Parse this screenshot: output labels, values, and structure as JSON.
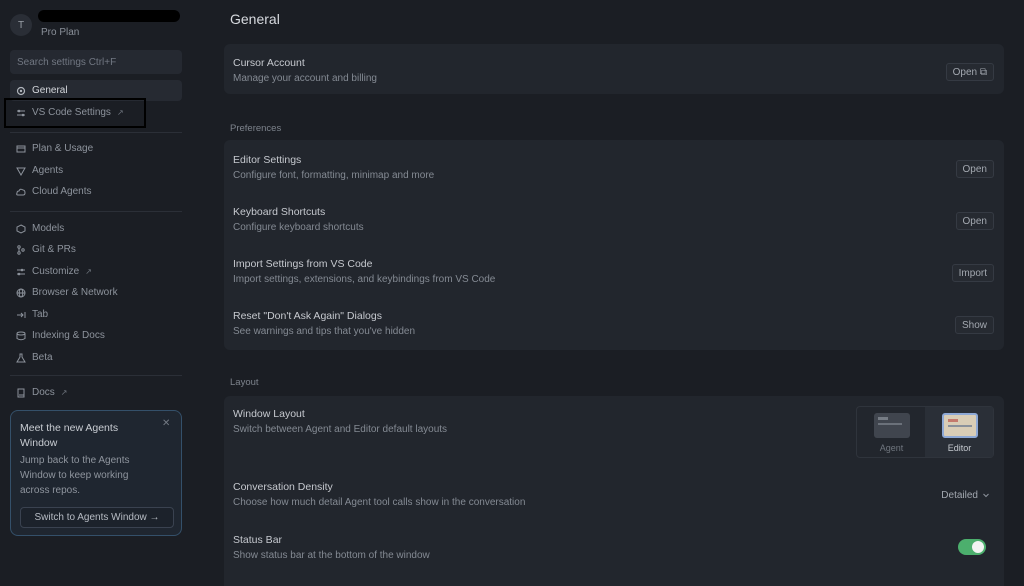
{
  "sidebar": {
    "avatar_letter": "T",
    "plan": "Pro Plan",
    "search_placeholder": "Search settings Ctrl+F",
    "items": [
      {
        "label": "General",
        "icon": "gear-icon"
      },
      {
        "label": "VS Code Settings",
        "icon": "sliders-icon",
        "external": "↗"
      },
      {
        "label": "Plan & Usage",
        "icon": "card-icon"
      },
      {
        "label": "Agents",
        "icon": "agent-icon"
      },
      {
        "label": "Cloud Agents",
        "icon": "cloud-icon"
      },
      {
        "label": "Models",
        "icon": "cube-icon"
      },
      {
        "label": "Git & PRs",
        "icon": "git-icon"
      },
      {
        "label": "Customize",
        "icon": "sliders-icon",
        "external": "↗"
      },
      {
        "label": "Browser & Network",
        "icon": "globe-icon"
      },
      {
        "label": "Tab",
        "icon": "tab-icon"
      },
      {
        "label": "Indexing & Docs",
        "icon": "database-icon"
      },
      {
        "label": "Beta",
        "icon": "flask-icon"
      },
      {
        "label": "Docs",
        "icon": "book-icon",
        "external": "↗"
      }
    ],
    "promo": {
      "title": "Meet the new Agents Window",
      "body": "Jump back to the Agents Window to keep working across repos.",
      "button": "Switch to Agents Window →"
    }
  },
  "main": {
    "title": "General",
    "account": {
      "title": "Cursor Account",
      "desc": "Manage your account and billing",
      "button": "Open ⧉"
    },
    "preferences_label": "Preferences",
    "preferences": [
      {
        "title": "Editor Settings",
        "desc": "Configure font, formatting, minimap and more",
        "button": "Open"
      },
      {
        "title": "Keyboard Shortcuts",
        "desc": "Configure keyboard shortcuts",
        "button": "Open"
      },
      {
        "title": "Import Settings from VS Code",
        "desc": "Import settings, extensions, and keybindings from VS Code",
        "button": "Import"
      },
      {
        "title": "Reset \"Don't Ask Again\" Dialogs",
        "desc": "See warnings and tips that you've hidden",
        "button": "Show"
      }
    ],
    "layout_label": "Layout",
    "window_layout": {
      "title": "Window Layout",
      "desc": "Switch between Agent and Editor default layouts",
      "options": [
        "Agent",
        "Editor"
      ],
      "selected": "Editor"
    },
    "density": {
      "title": "Conversation Density",
      "desc": "Choose how much detail Agent tool calls show in the conversation",
      "value": "Detailed"
    },
    "status_bar": {
      "title": "Status Bar",
      "desc": "Show status bar at the bottom of the window",
      "enabled": true
    }
  },
  "colors": {
    "toggle_on": "#4caf6d",
    "promo_border": "#34506a"
  }
}
